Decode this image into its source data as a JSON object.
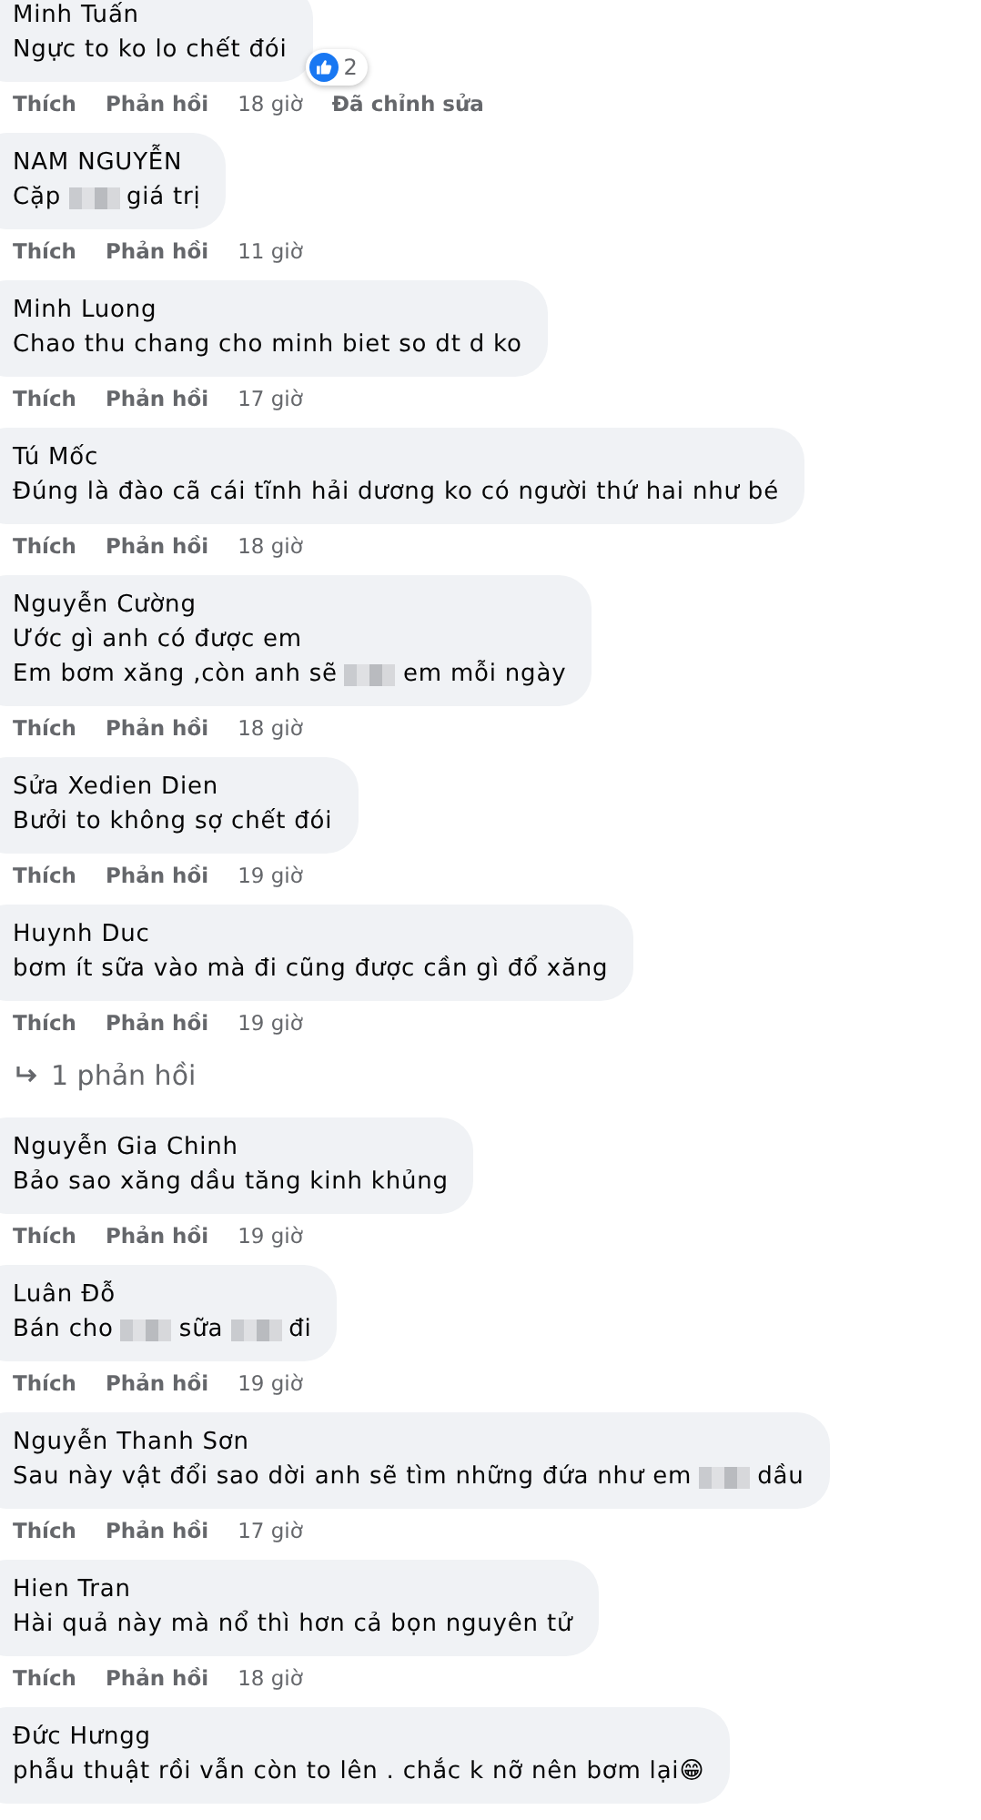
{
  "comments": [
    {
      "author": "Minh Tuấn",
      "lines": [
        [
          {
            "kind": "text",
            "text": "Ngực to ko lo chết đói"
          }
        ]
      ],
      "reactions": {
        "count": "2"
      },
      "actions": {
        "like": "Thích",
        "reply": "Phản hồi",
        "time": "18 giờ",
        "edited": "Đã chỉnh sửa"
      }
    },
    {
      "author": "NAM NGUYỄN",
      "lines": [
        [
          {
            "kind": "text",
            "text": "Cặp"
          },
          {
            "kind": "blur"
          },
          {
            "kind": "text",
            "text": "giá trị"
          }
        ]
      ],
      "actions": {
        "like": "Thích",
        "reply": "Phản hồi",
        "time": "11 giờ"
      }
    },
    {
      "author": "Minh Luong",
      "lines": [
        [
          {
            "kind": "text",
            "text": "Chao thu chang cho minh biet so dt d ko"
          }
        ]
      ],
      "actions": {
        "like": "Thích",
        "reply": "Phản hồi",
        "time": "17 giờ"
      }
    },
    {
      "author": "Tú Mốc",
      "lines": [
        [
          {
            "kind": "text",
            "text": "Đúng là đào cã cái tĩnh hải dương ko có người thứ hai như bé"
          }
        ]
      ],
      "actions": {
        "like": "Thích",
        "reply": "Phản hồi",
        "time": "18 giờ"
      }
    },
    {
      "author": "Nguyễn Cường",
      "lines": [
        [
          {
            "kind": "text",
            "text": "Ước gì anh có được em"
          }
        ],
        [
          {
            "kind": "text",
            "text": "Em bơm xăng ,còn anh sẽ"
          },
          {
            "kind": "blur"
          },
          {
            "kind": "text",
            "text": "em mỗi ngày"
          }
        ]
      ],
      "actions": {
        "like": "Thích",
        "reply": "Phản hồi",
        "time": "18 giờ"
      }
    },
    {
      "author": "Sửa Xedien Dien",
      "lines": [
        [
          {
            "kind": "text",
            "text": "Bưởi to không sợ chết đói"
          }
        ]
      ],
      "actions": {
        "like": "Thích",
        "reply": "Phản hồi",
        "time": "19 giờ"
      }
    },
    {
      "author": "Huynh Duc",
      "lines": [
        [
          {
            "kind": "text",
            "text": "bơm ít sữa vào mà đi cũng được cần gì đổ xăng"
          }
        ]
      ],
      "actions": {
        "like": "Thích",
        "reply": "Phản hồi",
        "time": "19 giờ"
      },
      "replies": "1 phản hồi"
    },
    {
      "author": "Nguyễn Gia Chinh",
      "lines": [
        [
          {
            "kind": "text",
            "text": "Bảo sao xăng dầu tăng kinh khủng"
          }
        ]
      ],
      "actions": {
        "like": "Thích",
        "reply": "Phản hồi",
        "time": "19 giờ"
      }
    },
    {
      "author": "Luân Đỗ",
      "lines": [
        [
          {
            "kind": "text",
            "text": "Bán cho"
          },
          {
            "kind": "blur"
          },
          {
            "kind": "text",
            "text": "sữa"
          },
          {
            "kind": "blur"
          },
          {
            "kind": "text",
            "text": "đi"
          }
        ]
      ],
      "actions": {
        "like": "Thích",
        "reply": "Phản hồi",
        "time": "19 giờ"
      }
    },
    {
      "author": "Nguyễn Thanh Sơn",
      "lines": [
        [
          {
            "kind": "text",
            "text": "Sau này vật đổi sao dời anh sẽ tìm những đứa như em"
          },
          {
            "kind": "blur"
          },
          {
            "kind": "text",
            "text": "dầu"
          }
        ]
      ],
      "actions": {
        "like": "Thích",
        "reply": "Phản hồi",
        "time": "17 giờ"
      }
    },
    {
      "author": "Hien Tran",
      "lines": [
        [
          {
            "kind": "text",
            "text": "Hài quả này mà nổ thì hơn cả bọn nguyên tử"
          }
        ]
      ],
      "actions": {
        "like": "Thích",
        "reply": "Phản hồi",
        "time": "18 giờ"
      }
    },
    {
      "author": "Đức Hưngg",
      "lines": [
        [
          {
            "kind": "text",
            "text": "phẫu thuật rồi vẫn còn to lên . chắc k nỡ nên bơm lại😁"
          }
        ]
      ]
    }
  ]
}
